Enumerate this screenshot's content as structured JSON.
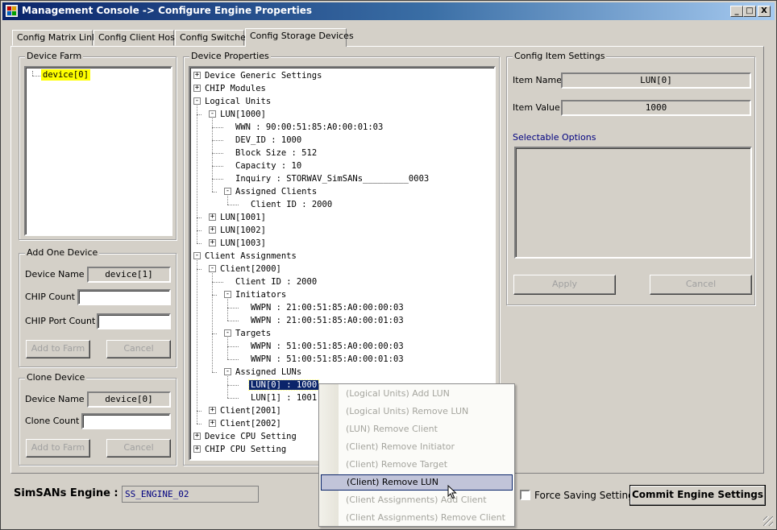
{
  "window": {
    "title": "Management Console -> Configure Engine Properties",
    "buttons": [
      "_",
      "□",
      "X"
    ]
  },
  "tabs": [
    {
      "label": "Config Matrix Links",
      "active": false
    },
    {
      "label": "Config Client Hosts",
      "active": false
    },
    {
      "label": "Config Switches",
      "active": false
    },
    {
      "label": "Config Storage Devices",
      "active": true
    }
  ],
  "device_farm": {
    "title": "Device Farm",
    "items": [
      "device[0]"
    ]
  },
  "add_one_device": {
    "title": "Add One Device",
    "device_name_label": "Device Name",
    "device_name_value": "device[1]",
    "chip_count_label": "CHIP Count",
    "chip_count_value": "",
    "chip_port_count_label": "CHIP Port Count",
    "chip_port_count_value": "",
    "add_button": "Add to Farm",
    "cancel_button": "Cancel"
  },
  "clone_device": {
    "title": "Clone Device",
    "device_name_label": "Device Name",
    "device_name_value": "device[0]",
    "clone_count_label": "Clone Count",
    "clone_count_value": "",
    "add_button": "Add to Farm",
    "cancel_button": "Cancel"
  },
  "device_properties": {
    "title": "Device Properties",
    "tree": [
      {
        "label": "Device Generic Settings",
        "level": 0,
        "expander": "+"
      },
      {
        "label": "CHIP Modules",
        "level": 0,
        "expander": "+"
      },
      {
        "label": "Logical Units",
        "level": 0,
        "expander": "-"
      },
      {
        "label": "LUN[1000]",
        "level": 1,
        "expander": "-"
      },
      {
        "label": "WWN : 90:00:51:85:A0:00:01:03",
        "level": 2,
        "expander": ""
      },
      {
        "label": "DEV_ID : 1000",
        "level": 2,
        "expander": ""
      },
      {
        "label": "Block Size : 512",
        "level": 2,
        "expander": ""
      },
      {
        "label": "Capacity : 10",
        "level": 2,
        "expander": ""
      },
      {
        "label": "Inquiry : STORWAV_SimSANs_________0003",
        "level": 2,
        "expander": ""
      },
      {
        "label": "Assigned Clients",
        "level": 2,
        "expander": "-"
      },
      {
        "label": "Client ID : 2000",
        "level": 3,
        "expander": ""
      },
      {
        "label": "LUN[1001]",
        "level": 1,
        "expander": "+"
      },
      {
        "label": "LUN[1002]",
        "level": 1,
        "expander": "+"
      },
      {
        "label": "LUN[1003]",
        "level": 1,
        "expander": "+"
      },
      {
        "label": "Client Assignments",
        "level": 0,
        "expander": "-"
      },
      {
        "label": "Client[2000]",
        "level": 1,
        "expander": "-"
      },
      {
        "label": "Client ID : 2000",
        "level": 2,
        "expander": ""
      },
      {
        "label": "Initiators",
        "level": 2,
        "expander": "-"
      },
      {
        "label": "WWPN : 21:00:51:85:A0:00:00:03",
        "level": 3,
        "expander": ""
      },
      {
        "label": "WWPN : 21:00:51:85:A0:00:01:03",
        "level": 3,
        "expander": ""
      },
      {
        "label": "Targets",
        "level": 2,
        "expander": "-"
      },
      {
        "label": "WWPN : 51:00:51:85:A0:00:00:03",
        "level": 3,
        "expander": ""
      },
      {
        "label": "WWPN : 51:00:51:85:A0:00:01:03",
        "level": 3,
        "expander": ""
      },
      {
        "label": "Assigned LUNs",
        "level": 2,
        "expander": "-"
      },
      {
        "label": "LUN[0] : 1000",
        "level": 3,
        "expander": "",
        "selected": true
      },
      {
        "label": "LUN[1] : 1001",
        "level": 3,
        "expander": ""
      },
      {
        "label": "Client[2001]",
        "level": 1,
        "expander": "+"
      },
      {
        "label": "Client[2002]",
        "level": 1,
        "expander": "+"
      },
      {
        "label": "Device CPU Setting",
        "level": 0,
        "expander": "+"
      },
      {
        "label": "CHIP CPU Setting",
        "level": 0,
        "expander": "+"
      }
    ]
  },
  "config_item": {
    "title": "Config Item Settings",
    "item_name_label": "Item Name",
    "item_name_value": "LUN[0]",
    "item_value_label": "Item Value",
    "item_value_value": "1000",
    "options_label": "Selectable Options",
    "apply_button": "Apply",
    "cancel_button": "Cancel"
  },
  "context_menu": {
    "items": [
      {
        "label": "(Logical Units) Add LUN",
        "enabled": false
      },
      {
        "label": "(Logical Units) Remove LUN",
        "enabled": false
      },
      {
        "label": "(LUN) Remove Client",
        "enabled": false
      },
      {
        "label": "(Client) Remove Initiator",
        "enabled": false
      },
      {
        "label": "(Client) Remove Target",
        "enabled": false
      },
      {
        "label": "(Client) Remove LUN",
        "enabled": true,
        "hover": true
      },
      {
        "label": "(Client Assignments) Add Client",
        "enabled": false
      },
      {
        "label": "(Client Assignments) Remove Client",
        "enabled": false
      }
    ]
  },
  "footer": {
    "engine_label": "SimSANs Engine :",
    "engine_value": "SS_ENGINE_02",
    "force_saving_label": "Force Saving Settings",
    "force_saving_checked": false,
    "commit_button": "Commit Engine Settings"
  },
  "colors": {
    "title_gradient_start": "#0a246a",
    "selection": "#0a246a",
    "farm_highlight": "#ffff00",
    "link_blue": "#000080"
  }
}
